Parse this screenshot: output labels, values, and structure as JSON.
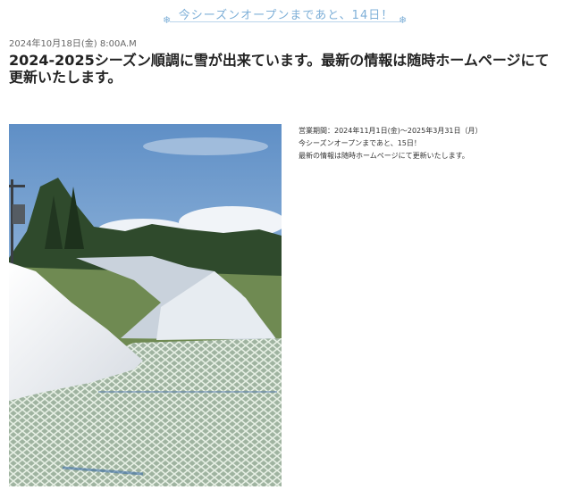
{
  "banner": {
    "text": "今シーズンオープンまであと、14日！",
    "snowflake_icon": "snowflake-icon"
  },
  "post": {
    "date": "2024年10月18日(金) 8:00A.M",
    "title": "2024-2025シーズン順調に雪が出来ています。最新の情報は随時ホームページにて更新いたします。",
    "info_lines": [
      "営業期間：2024年11月1日(金)〜2025年3月31日（月）",
      "今シーズンオープンまであと、15日！",
      "最新の情報は随時ホームページにて更新いたします。"
    ]
  },
  "colors": {
    "banner_accent": "#7fb0d8",
    "title_text": "#222222"
  }
}
